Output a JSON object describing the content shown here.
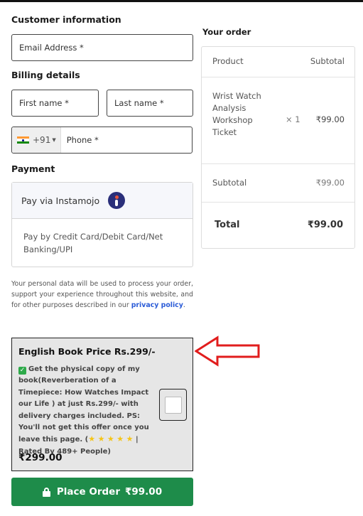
{
  "customer": {
    "title": "Customer information",
    "email_placeholder": "Email Address *"
  },
  "billing": {
    "title": "Billing details",
    "first_name_placeholder": "First name *",
    "last_name_placeholder": "Last name *",
    "phone_dial_code": "+91",
    "phone_placeholder": "Phone *"
  },
  "payment": {
    "title": "Payment",
    "method_label": "Pay via Instamojo",
    "method_description": "Pay by Credit Card/Debit Card/Net Banking/UPI"
  },
  "privacy": {
    "text": "Your personal data will be used to process your order, support your experience throughout this website, and for other purposes described in our ",
    "link": "privacy policy",
    "end": "."
  },
  "order": {
    "title": "Your order",
    "col_product": "Product",
    "col_subtotal": "Subtotal",
    "items": [
      {
        "name": "Wrist Watch Analysis Workshop Ticket",
        "qty": "× 1",
        "price": "₹99.00"
      }
    ],
    "subtotal_label": "Subtotal",
    "subtotal_value": "₹99.00",
    "total_label": "Total",
    "total_value": "₹99.00"
  },
  "offer": {
    "title": "English Book Price Rs.299/-",
    "text": "Get the physical copy of my book(Reverberation of a Timepiece: How Watches Impact our Life ) at just Rs.299/- with delivery charges included. PS: You'll not get this offer once you leave this page. (",
    "rating_text": " | Rated By 489+ People)",
    "stars": 5,
    "checked": false,
    "price": "₹299.00"
  },
  "place_order": {
    "label": "Place Order",
    "amount": "₹99.00"
  },
  "colors": {
    "button_green": "#1e8c4a",
    "link_blue": "#2a5bd7",
    "arrow_red": "#e11d1d"
  },
  "icons": [
    "india-flag-icon",
    "instamojo-logo-icon",
    "check-emoji-icon",
    "star-icon",
    "red-arrow-icon",
    "lock-icon"
  ]
}
